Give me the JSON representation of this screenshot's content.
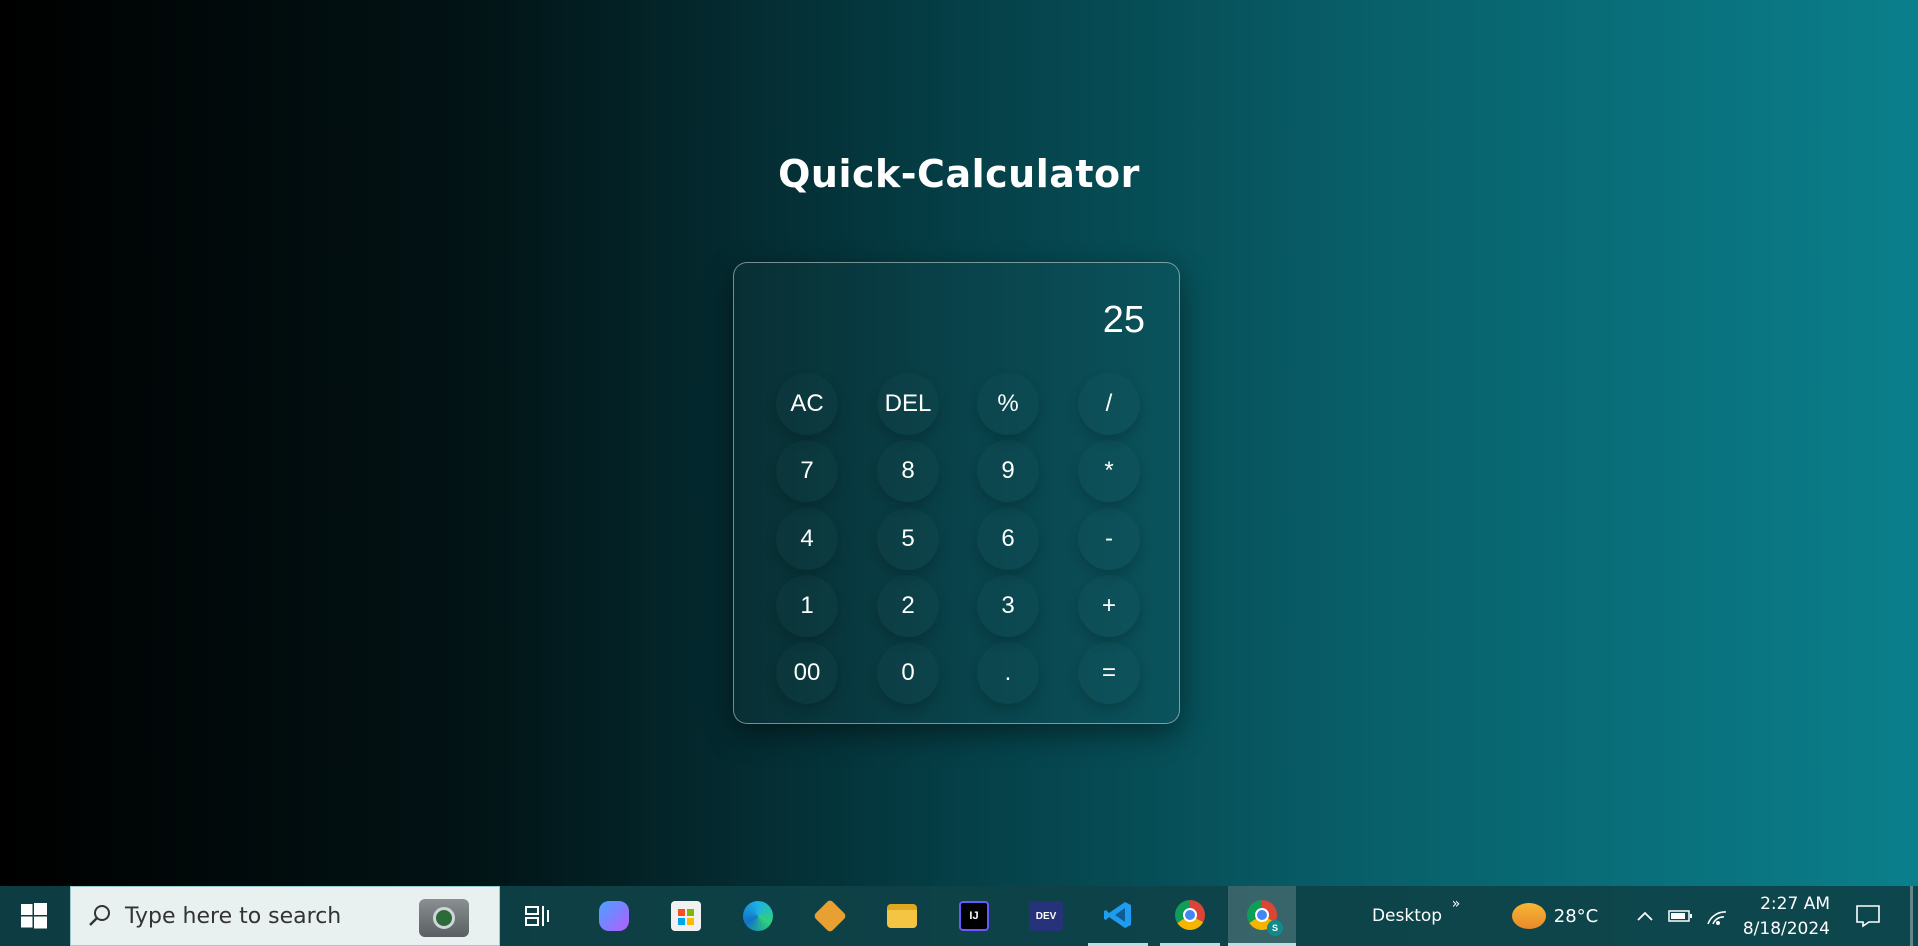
{
  "page": {
    "title": "Quick-Calculator"
  },
  "calculator": {
    "display": "25",
    "keys": [
      "AC",
      "DEL",
      "%",
      "/",
      "7",
      "8",
      "9",
      "*",
      "4",
      "5",
      "6",
      "-",
      "1",
      "2",
      "3",
      "+",
      "00",
      "0",
      ".",
      "="
    ]
  },
  "taskbar": {
    "search_placeholder": "Type here to search",
    "apps": [
      "task-view",
      "copilot",
      "microsoft-store",
      "edge",
      "git",
      "file-explorer",
      "intellij",
      "devc",
      "vscode",
      "chrome",
      "chrome-profile"
    ],
    "desktop_label": "Desktop",
    "weather": {
      "temp": "28°C"
    },
    "clock": {
      "time": "2:27 AM",
      "date": "8/18/2024"
    }
  },
  "colors": {
    "bg_left": "#000000",
    "bg_right": "#0a7f8b",
    "card_border": "#7fa9ad"
  }
}
